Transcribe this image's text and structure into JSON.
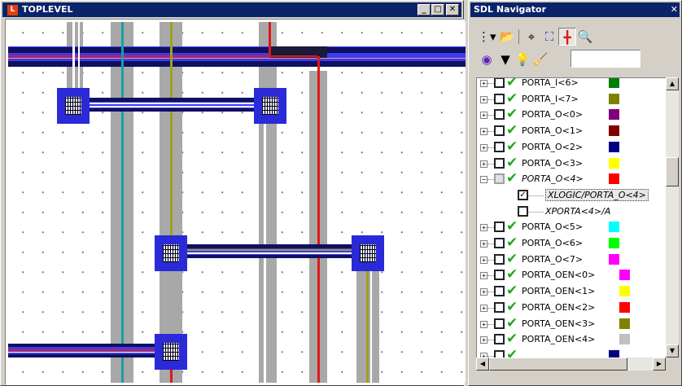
{
  "toplevel_window": {
    "title": "TOPLEVEL",
    "icon_letter": "L",
    "minimize": "_",
    "maximize": "□",
    "close": "✕"
  },
  "navigator_window": {
    "title": "SDL Navigator",
    "close": "✕",
    "toolbar_row1": [
      "tree-view-icon",
      "open-folder-icon",
      "crosshair-icon",
      "net-select-icon",
      "highlight-icon",
      "zoom-search-icon"
    ],
    "toolbar_row2": [
      "target-icon",
      "dropdown-arrow-icon",
      "lightbulb-icon",
      "eraser-icon"
    ],
    "search_value": "",
    "items": [
      {
        "label": "PORTA_I<6>",
        "color": "#008000",
        "checked": false,
        "visible": true,
        "level": 0,
        "expander": "+",
        "italic": false
      },
      {
        "label": "PORTA_I<7>",
        "color": "#808000",
        "checked": false,
        "visible": true,
        "level": 0,
        "expander": "+",
        "italic": false
      },
      {
        "label": "PORTA_O<0>",
        "color": "#800080",
        "checked": false,
        "visible": true,
        "level": 0,
        "expander": "+",
        "italic": false
      },
      {
        "label": "PORTA_O<1>",
        "color": "#800000",
        "checked": false,
        "visible": true,
        "level": 0,
        "expander": "+",
        "italic": false
      },
      {
        "label": "PORTA_O<2>",
        "color": "#000080",
        "checked": false,
        "visible": true,
        "level": 0,
        "expander": "+",
        "italic": false
      },
      {
        "label": "PORTA_O<3>",
        "color": "#ffff00",
        "checked": false,
        "visible": true,
        "level": 0,
        "expander": "+",
        "italic": false
      },
      {
        "label": "PORTA_O<4>",
        "color": "#ff0000",
        "checked": "partial",
        "visible": true,
        "level": 0,
        "expander": "−",
        "italic": true
      },
      {
        "label": "XLOGIC/PORTA_O<4>",
        "color": "",
        "checked": true,
        "visible": false,
        "level": 1,
        "expander": "",
        "italic": true,
        "highlight": true
      },
      {
        "label": "XPORTA<4>/A",
        "color": "",
        "checked": false,
        "visible": false,
        "level": 1,
        "expander": "",
        "italic": true
      },
      {
        "label": "PORTA_O<5>",
        "color": "#00ffff",
        "checked": false,
        "visible": true,
        "level": 0,
        "expander": "+",
        "italic": false
      },
      {
        "label": "PORTA_O<6>",
        "color": "#00ff00",
        "checked": false,
        "visible": true,
        "level": 0,
        "expander": "+",
        "italic": false
      },
      {
        "label": "PORTA_O<7>",
        "color": "#ff00ff",
        "checked": false,
        "visible": true,
        "level": 0,
        "expander": "+",
        "italic": false
      },
      {
        "label": "PORTA_OEN<0>",
        "color": "#ff00ff",
        "checked": false,
        "visible": true,
        "level": 0,
        "expander": "+",
        "italic": false
      },
      {
        "label": "PORTA_OEN<1>",
        "color": "#ffff00",
        "checked": false,
        "visible": true,
        "level": 0,
        "expander": "+",
        "italic": false
      },
      {
        "label": "PORTA_OEN<2>",
        "color": "#ff0000",
        "checked": false,
        "visible": true,
        "level": 0,
        "expander": "+",
        "italic": false
      },
      {
        "label": "PORTA_OEN<3>",
        "color": "#808000",
        "checked": false,
        "visible": true,
        "level": 0,
        "expander": "+",
        "italic": false
      },
      {
        "label": "PORTA_OEN<4>",
        "color": "#c0c0c0",
        "checked": false,
        "visible": true,
        "level": 0,
        "expander": "+",
        "italic": false
      },
      {
        "label": "",
        "color": "#000080",
        "checked": false,
        "visible": true,
        "level": 0,
        "expander": "+",
        "italic": false
      }
    ]
  },
  "colors": {
    "metal_blue": "#3c3cf0",
    "metal_dark": "#10106a",
    "wire_red": "#e01818",
    "wire_olive": "#a0a020",
    "wire_teal": "#18a0a0",
    "track_gray": "#a8a8a8"
  }
}
